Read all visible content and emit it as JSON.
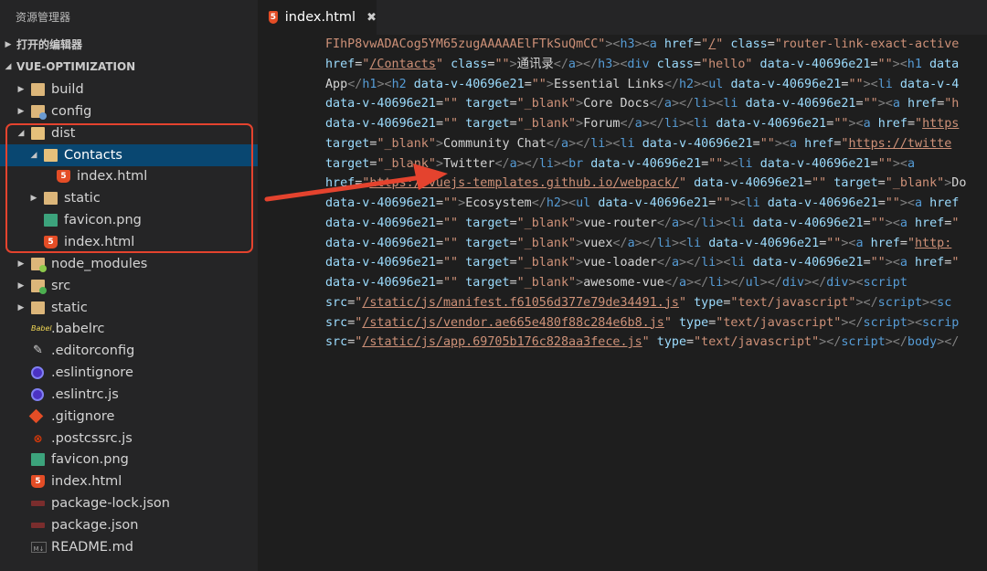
{
  "sidebar": {
    "title": "资源管理器",
    "open_editors": "打开的编辑器",
    "project": "VUE-OPTIMIZATION",
    "items": [
      {
        "label": "build",
        "icon": "folder-icon",
        "depth": 0,
        "twisty": "▶"
      },
      {
        "label": "config",
        "icon": "folder-config-icon",
        "depth": 0,
        "twisty": "▶"
      },
      {
        "label": "dist",
        "icon": "folder-open-icon",
        "depth": 0,
        "twisty": "◢"
      },
      {
        "label": "Contacts",
        "icon": "folder-open-icon",
        "depth": 1,
        "twisty": "◢",
        "selected": true
      },
      {
        "label": "index.html",
        "icon": "html5-icon",
        "depth": 2,
        "twisty": ""
      },
      {
        "label": "static",
        "icon": "folder-icon",
        "depth": 1,
        "twisty": "▶"
      },
      {
        "label": "favicon.png",
        "icon": "image-icon",
        "depth": 1,
        "twisty": ""
      },
      {
        "label": "index.html",
        "icon": "html5-icon",
        "depth": 1,
        "twisty": ""
      },
      {
        "label": "node_modules",
        "icon": "folder-node-icon",
        "depth": 0,
        "twisty": "▶"
      },
      {
        "label": "src",
        "icon": "folder-src-icon",
        "depth": 0,
        "twisty": "▶"
      },
      {
        "label": "static",
        "icon": "folder-icon",
        "depth": 0,
        "twisty": "▶"
      },
      {
        "label": ".babelrc",
        "icon": "babel-icon",
        "depth": 0,
        "twisty": ""
      },
      {
        "label": ".editorconfig",
        "icon": "editorconfig-icon",
        "depth": 0,
        "twisty": ""
      },
      {
        "label": ".eslintignore",
        "icon": "eslint-icon",
        "depth": 0,
        "twisty": ""
      },
      {
        "label": ".eslintrc.js",
        "icon": "eslint-icon",
        "depth": 0,
        "twisty": ""
      },
      {
        "label": ".gitignore",
        "icon": "git-icon",
        "depth": 0,
        "twisty": ""
      },
      {
        "label": ".postcssrc.js",
        "icon": "postcss-icon",
        "depth": 0,
        "twisty": ""
      },
      {
        "label": "favicon.png",
        "icon": "image-icon",
        "depth": 0,
        "twisty": ""
      },
      {
        "label": "index.html",
        "icon": "html5-icon",
        "depth": 0,
        "twisty": ""
      },
      {
        "label": "package-lock.json",
        "icon": "npm-icon",
        "depth": 0,
        "twisty": ""
      },
      {
        "label": "package.json",
        "icon": "npm-icon",
        "depth": 0,
        "twisty": ""
      },
      {
        "label": "README.md",
        "icon": "markdown-icon",
        "depth": 0,
        "twisty": ""
      }
    ]
  },
  "tab": {
    "label": "index.html",
    "close": "✖",
    "icon_text": "5"
  },
  "code_lines": [
    [
      [
        "st",
        "FIhP8vwADACog5YM65zugAAAAAElFTkSuQmCC\""
      ],
      [
        "tag",
        "><"
      ],
      [
        "tn",
        "h3"
      ],
      [
        "tag",
        "><"
      ],
      [
        "tn",
        "a"
      ],
      [
        "tx",
        " "
      ],
      [
        "at",
        "href"
      ],
      [
        "tx",
        "="
      ],
      [
        "st",
        "\""
      ],
      [
        "ul",
        "/"
      ],
      [
        "st",
        "\""
      ],
      [
        "tx",
        " "
      ],
      [
        "at",
        "class"
      ],
      [
        "tx",
        "="
      ],
      [
        "st",
        "\"router-link-exact-active"
      ]
    ],
    [
      [
        "at",
        "href"
      ],
      [
        "tx",
        "="
      ],
      [
        "st",
        "\""
      ],
      [
        "ul",
        "/Contacts"
      ],
      [
        "st",
        "\""
      ],
      [
        "tx",
        " "
      ],
      [
        "at",
        "class"
      ],
      [
        "tx",
        "="
      ],
      [
        "st",
        "\"\""
      ],
      [
        "tag",
        ">"
      ],
      [
        "tx",
        "通讯录"
      ],
      [
        "tag",
        "</"
      ],
      [
        "tn",
        "a"
      ],
      [
        "tag",
        "></"
      ],
      [
        "tn",
        "h3"
      ],
      [
        "tag",
        "><"
      ],
      [
        "tn",
        "div"
      ],
      [
        "tx",
        " "
      ],
      [
        "at",
        "class"
      ],
      [
        "tx",
        "="
      ],
      [
        "st",
        "\"hello\""
      ],
      [
        "tx",
        " "
      ],
      [
        "at",
        "data-v-40696e21"
      ],
      [
        "tx",
        "="
      ],
      [
        "st",
        "\"\""
      ],
      [
        "tag",
        "><"
      ],
      [
        "tn",
        "h1"
      ],
      [
        "tx",
        " "
      ],
      [
        "at",
        "data"
      ]
    ],
    [
      [
        "tx",
        "App"
      ],
      [
        "tag",
        "</"
      ],
      [
        "tn",
        "h1"
      ],
      [
        "tag",
        "><"
      ],
      [
        "tn",
        "h2"
      ],
      [
        "tx",
        " "
      ],
      [
        "at",
        "data-v-40696e21"
      ],
      [
        "tx",
        "="
      ],
      [
        "st",
        "\"\""
      ],
      [
        "tag",
        ">"
      ],
      [
        "tx",
        "Essential Links"
      ],
      [
        "tag",
        "</"
      ],
      [
        "tn",
        "h2"
      ],
      [
        "tag",
        "><"
      ],
      [
        "tn",
        "ul"
      ],
      [
        "tx",
        " "
      ],
      [
        "at",
        "data-v-40696e21"
      ],
      [
        "tx",
        "="
      ],
      [
        "st",
        "\"\""
      ],
      [
        "tag",
        "><"
      ],
      [
        "tn",
        "li"
      ],
      [
        "tx",
        " "
      ],
      [
        "at",
        "data-v-4"
      ]
    ],
    [
      [
        "at",
        "data-v-40696e21"
      ],
      [
        "tx",
        "="
      ],
      [
        "st",
        "\"\""
      ],
      [
        "tx",
        " "
      ],
      [
        "at",
        "target"
      ],
      [
        "tx",
        "="
      ],
      [
        "st",
        "\"_blank\""
      ],
      [
        "tag",
        ">"
      ],
      [
        "tx",
        "Core Docs"
      ],
      [
        "tag",
        "</"
      ],
      [
        "tn",
        "a"
      ],
      [
        "tag",
        "></"
      ],
      [
        "tn",
        "li"
      ],
      [
        "tag",
        "><"
      ],
      [
        "tn",
        "li"
      ],
      [
        "tx",
        " "
      ],
      [
        "at",
        "data-v-40696e21"
      ],
      [
        "tx",
        "="
      ],
      [
        "st",
        "\"\""
      ],
      [
        "tag",
        "><"
      ],
      [
        "tn",
        "a"
      ],
      [
        "tx",
        " "
      ],
      [
        "at",
        "href"
      ],
      [
        "tx",
        "="
      ],
      [
        "st",
        "\"h"
      ]
    ],
    [
      [
        "at",
        "data-v-40696e21"
      ],
      [
        "tx",
        "="
      ],
      [
        "st",
        "\"\""
      ],
      [
        "tx",
        " "
      ],
      [
        "at",
        "target"
      ],
      [
        "tx",
        "="
      ],
      [
        "st",
        "\"_blank\""
      ],
      [
        "tag",
        ">"
      ],
      [
        "tx",
        "Forum"
      ],
      [
        "tag",
        "</"
      ],
      [
        "tn",
        "a"
      ],
      [
        "tag",
        "></"
      ],
      [
        "tn",
        "li"
      ],
      [
        "tag",
        "><"
      ],
      [
        "tn",
        "li"
      ],
      [
        "tx",
        " "
      ],
      [
        "at",
        "data-v-40696e21"
      ],
      [
        "tx",
        "="
      ],
      [
        "st",
        "\"\""
      ],
      [
        "tag",
        "><"
      ],
      [
        "tn",
        "a"
      ],
      [
        "tx",
        " "
      ],
      [
        "at",
        "href"
      ],
      [
        "tx",
        "="
      ],
      [
        "st",
        "\""
      ],
      [
        "ul",
        "https"
      ]
    ],
    [
      [
        "at",
        "target"
      ],
      [
        "tx",
        "="
      ],
      [
        "st",
        "\"_blank\""
      ],
      [
        "tag",
        ">"
      ],
      [
        "tx",
        "Community Chat"
      ],
      [
        "tag",
        "</"
      ],
      [
        "tn",
        "a"
      ],
      [
        "tag",
        "></"
      ],
      [
        "tn",
        "li"
      ],
      [
        "tag",
        "><"
      ],
      [
        "tn",
        "li"
      ],
      [
        "tx",
        " "
      ],
      [
        "at",
        "data-v-40696e21"
      ],
      [
        "tx",
        "="
      ],
      [
        "st",
        "\"\""
      ],
      [
        "tag",
        "><"
      ],
      [
        "tn",
        "a"
      ],
      [
        "tx",
        " "
      ],
      [
        "at",
        "href"
      ],
      [
        "tx",
        "="
      ],
      [
        "st",
        "\""
      ],
      [
        "ul",
        "https://twitte"
      ]
    ],
    [
      [
        "at",
        "target"
      ],
      [
        "tx",
        "="
      ],
      [
        "st",
        "\"_blank\""
      ],
      [
        "tag",
        ">"
      ],
      [
        "tx",
        "Twitter"
      ],
      [
        "tag",
        "</"
      ],
      [
        "tn",
        "a"
      ],
      [
        "tag",
        "></"
      ],
      [
        "tn",
        "li"
      ],
      [
        "tag",
        "><"
      ],
      [
        "tn",
        "br"
      ],
      [
        "tx",
        " "
      ],
      [
        "at",
        "data-v-40696e21"
      ],
      [
        "tx",
        "="
      ],
      [
        "st",
        "\"\""
      ],
      [
        "tag",
        "><"
      ],
      [
        "tn",
        "li"
      ],
      [
        "tx",
        " "
      ],
      [
        "at",
        "data-v-40696e21"
      ],
      [
        "tx",
        "="
      ],
      [
        "st",
        "\"\""
      ],
      [
        "tag",
        "><"
      ],
      [
        "tn",
        "a"
      ]
    ],
    [
      [
        "at",
        "href"
      ],
      [
        "tx",
        "="
      ],
      [
        "st",
        "\""
      ],
      [
        "ul",
        "https://vuejs-templates.github.io/webpack/"
      ],
      [
        "st",
        "\""
      ],
      [
        "tx",
        " "
      ],
      [
        "at",
        "data-v-40696e21"
      ],
      [
        "tx",
        "="
      ],
      [
        "st",
        "\"\""
      ],
      [
        "tx",
        " "
      ],
      [
        "at",
        "target"
      ],
      [
        "tx",
        "="
      ],
      [
        "st",
        "\"_blank\""
      ],
      [
        "tag",
        ">"
      ],
      [
        "tx",
        "Do"
      ]
    ],
    [
      [
        "at",
        "data-v-40696e21"
      ],
      [
        "tx",
        "="
      ],
      [
        "st",
        "\"\""
      ],
      [
        "tag",
        ">"
      ],
      [
        "tx",
        "Ecosystem"
      ],
      [
        "tag",
        "</"
      ],
      [
        "tn",
        "h2"
      ],
      [
        "tag",
        "><"
      ],
      [
        "tn",
        "ul"
      ],
      [
        "tx",
        " "
      ],
      [
        "at",
        "data-v-40696e21"
      ],
      [
        "tx",
        "="
      ],
      [
        "st",
        "\"\""
      ],
      [
        "tag",
        "><"
      ],
      [
        "tn",
        "li"
      ],
      [
        "tx",
        " "
      ],
      [
        "at",
        "data-v-40696e21"
      ],
      [
        "tx",
        "="
      ],
      [
        "st",
        "\"\""
      ],
      [
        "tag",
        "><"
      ],
      [
        "tn",
        "a"
      ],
      [
        "tx",
        " "
      ],
      [
        "at",
        "href"
      ]
    ],
    [
      [
        "at",
        "data-v-40696e21"
      ],
      [
        "tx",
        "="
      ],
      [
        "st",
        "\"\""
      ],
      [
        "tx",
        " "
      ],
      [
        "at",
        "target"
      ],
      [
        "tx",
        "="
      ],
      [
        "st",
        "\"_blank\""
      ],
      [
        "tag",
        ">"
      ],
      [
        "tx",
        "vue-router"
      ],
      [
        "tag",
        "</"
      ],
      [
        "tn",
        "a"
      ],
      [
        "tag",
        "></"
      ],
      [
        "tn",
        "li"
      ],
      [
        "tag",
        "><"
      ],
      [
        "tn",
        "li"
      ],
      [
        "tx",
        " "
      ],
      [
        "at",
        "data-v-40696e21"
      ],
      [
        "tx",
        "="
      ],
      [
        "st",
        "\"\""
      ],
      [
        "tag",
        "><"
      ],
      [
        "tn",
        "a"
      ],
      [
        "tx",
        " "
      ],
      [
        "at",
        "href"
      ],
      [
        "tx",
        "="
      ],
      [
        "st",
        "\""
      ]
    ],
    [
      [
        "at",
        "data-v-40696e21"
      ],
      [
        "tx",
        "="
      ],
      [
        "st",
        "\"\""
      ],
      [
        "tx",
        " "
      ],
      [
        "at",
        "target"
      ],
      [
        "tx",
        "="
      ],
      [
        "st",
        "\"_blank\""
      ],
      [
        "tag",
        ">"
      ],
      [
        "tx",
        "vuex"
      ],
      [
        "tag",
        "</"
      ],
      [
        "tn",
        "a"
      ],
      [
        "tag",
        "></"
      ],
      [
        "tn",
        "li"
      ],
      [
        "tag",
        "><"
      ],
      [
        "tn",
        "li"
      ],
      [
        "tx",
        " "
      ],
      [
        "at",
        "data-v-40696e21"
      ],
      [
        "tx",
        "="
      ],
      [
        "st",
        "\"\""
      ],
      [
        "tag",
        "><"
      ],
      [
        "tn",
        "a"
      ],
      [
        "tx",
        " "
      ],
      [
        "at",
        "href"
      ],
      [
        "tx",
        "="
      ],
      [
        "st",
        "\""
      ],
      [
        "ul",
        "http:"
      ]
    ],
    [
      [
        "at",
        "data-v-40696e21"
      ],
      [
        "tx",
        "="
      ],
      [
        "st",
        "\"\""
      ],
      [
        "tx",
        " "
      ],
      [
        "at",
        "target"
      ],
      [
        "tx",
        "="
      ],
      [
        "st",
        "\"_blank\""
      ],
      [
        "tag",
        ">"
      ],
      [
        "tx",
        "vue-loader"
      ],
      [
        "tag",
        "</"
      ],
      [
        "tn",
        "a"
      ],
      [
        "tag",
        "></"
      ],
      [
        "tn",
        "li"
      ],
      [
        "tag",
        "><"
      ],
      [
        "tn",
        "li"
      ],
      [
        "tx",
        " "
      ],
      [
        "at",
        "data-v-40696e21"
      ],
      [
        "tx",
        "="
      ],
      [
        "st",
        "\"\""
      ],
      [
        "tag",
        "><"
      ],
      [
        "tn",
        "a"
      ],
      [
        "tx",
        " "
      ],
      [
        "at",
        "href"
      ],
      [
        "tx",
        "="
      ],
      [
        "st",
        "\""
      ]
    ],
    [
      [
        "at",
        "data-v-40696e21"
      ],
      [
        "tx",
        "="
      ],
      [
        "st",
        "\"\""
      ],
      [
        "tx",
        " "
      ],
      [
        "at",
        "target"
      ],
      [
        "tx",
        "="
      ],
      [
        "st",
        "\"_blank\""
      ],
      [
        "tag",
        ">"
      ],
      [
        "tx",
        "awesome-vue"
      ],
      [
        "tag",
        "</"
      ],
      [
        "tn",
        "a"
      ],
      [
        "tag",
        "></"
      ],
      [
        "tn",
        "li"
      ],
      [
        "tag",
        "></"
      ],
      [
        "tn",
        "ul"
      ],
      [
        "tag",
        "></"
      ],
      [
        "tn",
        "div"
      ],
      [
        "tag",
        "></"
      ],
      [
        "tn",
        "div"
      ],
      [
        "tag",
        "><"
      ],
      [
        "tn",
        "script"
      ]
    ],
    [
      [
        "at",
        "src"
      ],
      [
        "tx",
        "="
      ],
      [
        "st",
        "\""
      ],
      [
        "ul",
        "/static/js/manifest.f61056d377e79de34491.js"
      ],
      [
        "st",
        "\""
      ],
      [
        "tx",
        " "
      ],
      [
        "at",
        "type"
      ],
      [
        "tx",
        "="
      ],
      [
        "st",
        "\"text/javascript\""
      ],
      [
        "tag",
        "></"
      ],
      [
        "tn",
        "script"
      ],
      [
        "tag",
        "><"
      ],
      [
        "tn",
        "sc"
      ]
    ],
    [
      [
        "at",
        "src"
      ],
      [
        "tx",
        "="
      ],
      [
        "st",
        "\""
      ],
      [
        "ul",
        "/static/js/vendor.ae665e480f88c284e6b8.js"
      ],
      [
        "st",
        "\""
      ],
      [
        "tx",
        " "
      ],
      [
        "at",
        "type"
      ],
      [
        "tx",
        "="
      ],
      [
        "st",
        "\"text/javascript\""
      ],
      [
        "tag",
        "></"
      ],
      [
        "tn",
        "script"
      ],
      [
        "tag",
        "><"
      ],
      [
        "tn",
        "scrip"
      ]
    ],
    [
      [
        "at",
        "src"
      ],
      [
        "tx",
        "="
      ],
      [
        "st",
        "\""
      ],
      [
        "ul",
        "/static/js/app.69705b176c828aa3fece.js"
      ],
      [
        "st",
        "\""
      ],
      [
        "tx",
        " "
      ],
      [
        "at",
        "type"
      ],
      [
        "tx",
        "="
      ],
      [
        "st",
        "\"text/javascript\""
      ],
      [
        "tag",
        "></"
      ],
      [
        "tn",
        "script"
      ],
      [
        "tag",
        "></"
      ],
      [
        "tn",
        "body"
      ],
      [
        "tag",
        "></"
      ]
    ]
  ]
}
